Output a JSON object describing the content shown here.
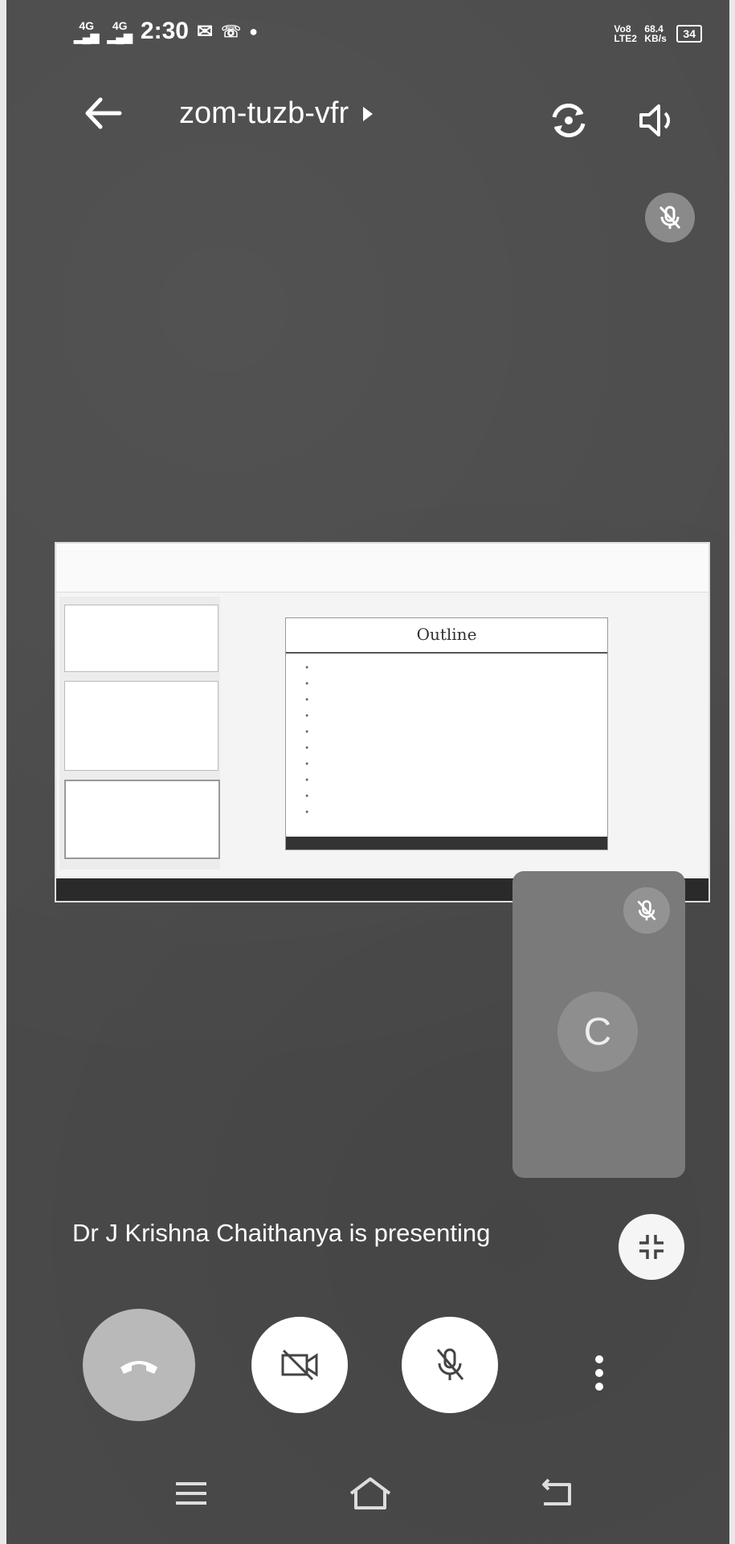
{
  "status_bar": {
    "signal_1": "4G",
    "signal_2": "4G",
    "time": "2:30",
    "volte": "Vo8 LTE2",
    "speed": "68.4 KB/s",
    "battery": "34"
  },
  "header": {
    "meeting_code": "zom-tuzb-vfr"
  },
  "shared_screen": {
    "slide_title": "Outline",
    "slide_items": [
      "",
      "",
      "",
      "",
      "",
      "",
      "",
      "",
      "",
      ""
    ]
  },
  "self_tile": {
    "avatar_initial": "C"
  },
  "presenting_text": "Dr J Krishna Chaithanya is presenting",
  "colors": {
    "background": "#4b4b4b",
    "end_call": "#b9b9b9",
    "control_bg": "#ffffff"
  },
  "icons": [
    "back-arrow-icon",
    "switch-camera-icon",
    "speaker-icon",
    "mic-off-icon",
    "collapse-icon",
    "end-call-icon",
    "camera-off-icon",
    "more-vert-icon",
    "menu-icon",
    "home-icon",
    "return-icon"
  ]
}
